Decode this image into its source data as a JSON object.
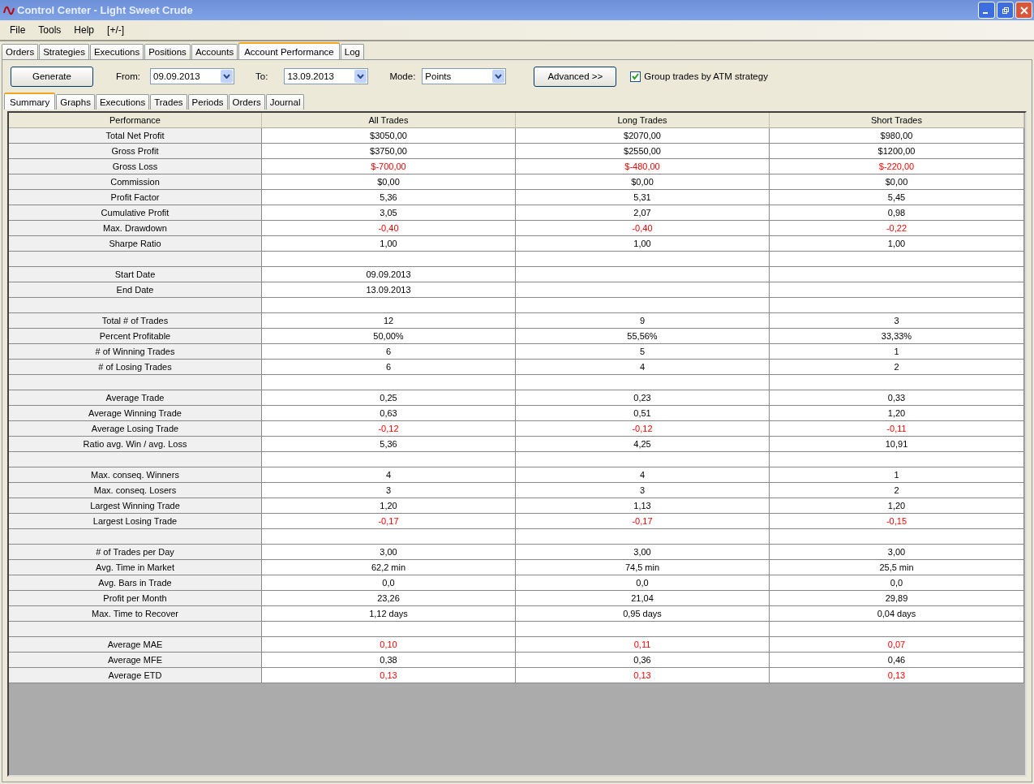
{
  "window": {
    "title": "Control Center - Light Sweet Crude"
  },
  "menu": [
    "File",
    "Tools",
    "Help",
    "[+/-]"
  ],
  "tabs": [
    {
      "label": "Orders",
      "selected": false
    },
    {
      "label": "Strategies",
      "selected": false
    },
    {
      "label": "Executions",
      "selected": false
    },
    {
      "label": "Positions",
      "selected": false
    },
    {
      "label": "Accounts",
      "selected": false
    },
    {
      "label": "Account Performance",
      "selected": true
    },
    {
      "label": "Log",
      "selected": false
    }
  ],
  "toolbar": {
    "generate": "Generate",
    "from_label": "From:",
    "from": "09.09.2013",
    "to_label": "To:",
    "to": "13.09.2013",
    "mode_label": "Mode:",
    "mode": "Points",
    "advanced": "Advanced >>",
    "group_checkbox": {
      "label": "Group trades by ATM strategy",
      "checked": true
    }
  },
  "subtabs": [
    {
      "label": "Summary",
      "selected": true
    },
    {
      "label": "Graphs",
      "selected": false
    },
    {
      "label": "Executions",
      "selected": false
    },
    {
      "label": "Trades",
      "selected": false
    },
    {
      "label": "Periods",
      "selected": false
    },
    {
      "label": "Orders",
      "selected": false
    },
    {
      "label": "Journal",
      "selected": false
    }
  ],
  "table": {
    "columns": [
      "Performance",
      "All Trades",
      "Long Trades",
      "Short Trades"
    ],
    "rows": [
      {
        "kind": "data",
        "label": "Total Net Profit",
        "cells": [
          {
            "text": "$3050,00",
            "negative": false
          },
          {
            "text": "$2070,00",
            "negative": false
          },
          {
            "text": "$980,00",
            "negative": false
          }
        ]
      },
      {
        "kind": "data",
        "label": "Gross Profit",
        "cells": [
          {
            "text": "$3750,00",
            "negative": false
          },
          {
            "text": "$2550,00",
            "negative": false
          },
          {
            "text": "$1200,00",
            "negative": false
          }
        ]
      },
      {
        "kind": "data",
        "label": "Gross Loss",
        "cells": [
          {
            "text": "$-700,00",
            "negative": true
          },
          {
            "text": "$-480,00",
            "negative": true
          },
          {
            "text": "$-220,00",
            "negative": true
          }
        ]
      },
      {
        "kind": "data",
        "label": "Commission",
        "cells": [
          {
            "text": "$0,00",
            "negative": false
          },
          {
            "text": "$0,00",
            "negative": false
          },
          {
            "text": "$0,00",
            "negative": false
          }
        ]
      },
      {
        "kind": "data",
        "label": "Profit Factor",
        "cells": [
          {
            "text": "5,36",
            "negative": false
          },
          {
            "text": "5,31",
            "negative": false
          },
          {
            "text": "5,45",
            "negative": false
          }
        ]
      },
      {
        "kind": "data",
        "label": "Cumulative Profit",
        "cells": [
          {
            "text": "3,05",
            "negative": false
          },
          {
            "text": "2,07",
            "negative": false
          },
          {
            "text": "0,98",
            "negative": false
          }
        ]
      },
      {
        "kind": "data",
        "label": "Max. Drawdown",
        "cells": [
          {
            "text": "-0,40",
            "negative": true
          },
          {
            "text": "-0,40",
            "negative": true
          },
          {
            "text": "-0,22",
            "negative": true
          }
        ]
      },
      {
        "kind": "data",
        "label": "Sharpe Ratio",
        "cells": [
          {
            "text": "1,00",
            "negative": false
          },
          {
            "text": "1,00",
            "negative": false
          },
          {
            "text": "1,00",
            "negative": false
          }
        ]
      },
      {
        "kind": "spacer"
      },
      {
        "kind": "data",
        "label": "Start Date",
        "cells": [
          {
            "text": "09.09.2013",
            "negative": false
          }
        ]
      },
      {
        "kind": "data",
        "label": "End Date",
        "cells": [
          {
            "text": "13.09.2013",
            "negative": false
          }
        ]
      },
      {
        "kind": "spacer"
      },
      {
        "kind": "data",
        "label": "Total # of Trades",
        "cells": [
          {
            "text": "12",
            "negative": false
          },
          {
            "text": "9",
            "negative": false
          },
          {
            "text": "3",
            "negative": false
          }
        ]
      },
      {
        "kind": "data",
        "label": "Percent Profitable",
        "cells": [
          {
            "text": "50,00%",
            "negative": false
          },
          {
            "text": "55,56%",
            "negative": false
          },
          {
            "text": "33,33%",
            "negative": false
          }
        ]
      },
      {
        "kind": "data",
        "label": "# of Winning Trades",
        "cells": [
          {
            "text": "6",
            "negative": false
          },
          {
            "text": "5",
            "negative": false
          },
          {
            "text": "1",
            "negative": false
          }
        ]
      },
      {
        "kind": "data",
        "label": "# of Losing Trades",
        "cells": [
          {
            "text": "6",
            "negative": false
          },
          {
            "text": "4",
            "negative": false
          },
          {
            "text": "2",
            "negative": false
          }
        ]
      },
      {
        "kind": "spacer"
      },
      {
        "kind": "data",
        "label": "Average Trade",
        "cells": [
          {
            "text": "0,25",
            "negative": false
          },
          {
            "text": "0,23",
            "negative": false
          },
          {
            "text": "0,33",
            "negative": false
          }
        ]
      },
      {
        "kind": "data",
        "label": "Average Winning Trade",
        "cells": [
          {
            "text": "0,63",
            "negative": false
          },
          {
            "text": "0,51",
            "negative": false
          },
          {
            "text": "1,20",
            "negative": false
          }
        ]
      },
      {
        "kind": "data",
        "label": "Average Losing Trade",
        "cells": [
          {
            "text": "-0,12",
            "negative": true
          },
          {
            "text": "-0,12",
            "negative": true
          },
          {
            "text": "-0,11",
            "negative": true
          }
        ]
      },
      {
        "kind": "data",
        "label": "Ratio avg. Win / avg. Loss",
        "cells": [
          {
            "text": "5,36",
            "negative": false
          },
          {
            "text": "4,25",
            "negative": false
          },
          {
            "text": "10,91",
            "negative": false
          }
        ]
      },
      {
        "kind": "spacer"
      },
      {
        "kind": "data",
        "label": "Max. conseq. Winners",
        "cells": [
          {
            "text": "4",
            "negative": false
          },
          {
            "text": "4",
            "negative": false
          },
          {
            "text": "1",
            "negative": false
          }
        ]
      },
      {
        "kind": "data",
        "label": "Max. conseq. Losers",
        "cells": [
          {
            "text": "3",
            "negative": false
          },
          {
            "text": "3",
            "negative": false
          },
          {
            "text": "2",
            "negative": false
          }
        ]
      },
      {
        "kind": "data",
        "label": "Largest Winning Trade",
        "cells": [
          {
            "text": "1,20",
            "negative": false
          },
          {
            "text": "1,13",
            "negative": false
          },
          {
            "text": "1,20",
            "negative": false
          }
        ]
      },
      {
        "kind": "data",
        "label": "Largest Losing Trade",
        "cells": [
          {
            "text": "-0,17",
            "negative": true
          },
          {
            "text": "-0,17",
            "negative": true
          },
          {
            "text": "-0,15",
            "negative": true
          }
        ]
      },
      {
        "kind": "spacer"
      },
      {
        "kind": "data",
        "label": "# of Trades per Day",
        "cells": [
          {
            "text": "3,00",
            "negative": false
          },
          {
            "text": "3,00",
            "negative": false
          },
          {
            "text": "3,00",
            "negative": false
          }
        ]
      },
      {
        "kind": "data",
        "label": "Avg. Time in Market",
        "cells": [
          {
            "text": "62,2 min",
            "negative": false
          },
          {
            "text": "74,5 min",
            "negative": false
          },
          {
            "text": "25,5 min",
            "negative": false
          }
        ]
      },
      {
        "kind": "data",
        "label": "Avg. Bars in Trade",
        "cells": [
          {
            "text": "0,0",
            "negative": false
          },
          {
            "text": "0,0",
            "negative": false
          },
          {
            "text": "0,0",
            "negative": false
          }
        ]
      },
      {
        "kind": "data",
        "label": "Profit per Month",
        "cells": [
          {
            "text": "23,26",
            "negative": false
          },
          {
            "text": "21,04",
            "negative": false
          },
          {
            "text": "29,89",
            "negative": false
          }
        ]
      },
      {
        "kind": "data",
        "label": "Max. Time to Recover",
        "cells": [
          {
            "text": "1,12 days",
            "negative": false
          },
          {
            "text": "0,95 days",
            "negative": false
          },
          {
            "text": "0,04 days",
            "negative": false
          }
        ]
      },
      {
        "kind": "spacer"
      },
      {
        "kind": "data",
        "label": "Average MAE",
        "cells": [
          {
            "text": "0,10",
            "negative": true
          },
          {
            "text": "0,11",
            "negative": true
          },
          {
            "text": "0,07",
            "negative": true
          }
        ]
      },
      {
        "kind": "data",
        "label": "Average MFE",
        "cells": [
          {
            "text": "0,38",
            "negative": false
          },
          {
            "text": "0,36",
            "negative": false
          },
          {
            "text": "0,46",
            "negative": false
          }
        ]
      },
      {
        "kind": "data",
        "label": "Average ETD",
        "cells": [
          {
            "text": "0,13",
            "negative": true
          },
          {
            "text": "0,13",
            "negative": true
          },
          {
            "text": "0,13",
            "negative": true
          }
        ]
      }
    ]
  }
}
